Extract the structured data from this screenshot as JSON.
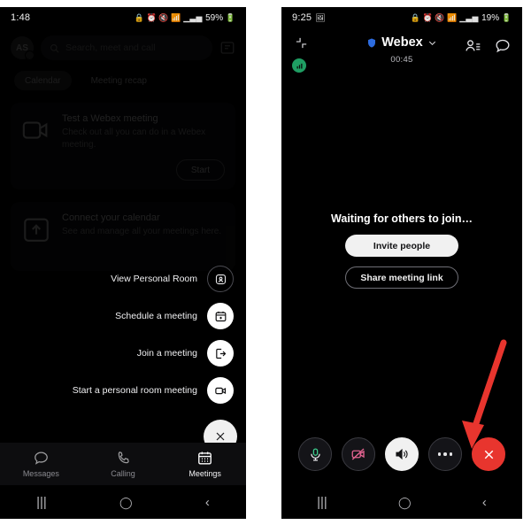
{
  "left_phone": {
    "status_bar": {
      "time": "1:48",
      "battery": "59%",
      "icons": [
        "lock-icon",
        "alarm-icon",
        "mute-icon",
        "wifi-icon",
        "signal-icon",
        "signal-bars-icon",
        "battery-icon"
      ]
    },
    "header": {
      "avatar_initials": "AS",
      "search_placeholder": "Search, meet and call",
      "compose_icon": "compose-icon"
    },
    "chips": [
      {
        "label": "Calendar",
        "filled": true
      },
      {
        "label": "Meeting recap",
        "filled": false
      }
    ],
    "cards": [
      {
        "icon": "video-camera-icon",
        "title": "Test a Webex meeting",
        "subtitle": "Check out all you can do in a Webex meeting.",
        "button": "Start"
      },
      {
        "icon": "calendar-connect-icon",
        "title": "Connect your calendar",
        "subtitle": "See and manage all your meetings here."
      }
    ],
    "fab_menu": {
      "items": [
        {
          "label": "View Personal Room",
          "icon": "personal-room-icon",
          "style": "ghost"
        },
        {
          "label": "Schedule a meeting",
          "icon": "calendar-plus-icon",
          "style": "white"
        },
        {
          "label": "Join a meeting",
          "icon": "join-meeting-icon",
          "style": "white"
        },
        {
          "label": "Start a personal room meeting",
          "icon": "video-start-icon",
          "style": "white"
        }
      ],
      "close_icon": "close-icon"
    },
    "tabs": [
      {
        "label": "Messages",
        "icon": "message-bubble-icon",
        "active": false
      },
      {
        "label": "Calling",
        "icon": "phone-icon",
        "active": false
      },
      {
        "label": "Meetings",
        "icon": "calendar-icon",
        "active": true
      }
    ],
    "nav_bar": {
      "recents": "recents-icon",
      "home": "home-icon",
      "back": "back-icon"
    }
  },
  "right_phone": {
    "status_bar": {
      "time": "9:25",
      "battery": "19%",
      "icons": [
        "screenshot-icon",
        "lock-icon",
        "alarm-icon",
        "mute-icon",
        "wifi-icon",
        "signal-icon",
        "signal-bars-icon",
        "battery-icon"
      ]
    },
    "meeting_header": {
      "collapse_icon": "collapse-icon",
      "network_quality_icon": "network-quality-icon",
      "shield_icon": "shield-icon",
      "title": "Webex",
      "chevron_icon": "chevron-down-icon",
      "timer": "00:45",
      "participants_icon": "participants-icon",
      "chat_icon": "chat-bubble-icon"
    },
    "center": {
      "waiting_text": "Waiting for others to join…",
      "invite_button": "Invite people",
      "share_button": "Share meeting link"
    },
    "controls": [
      {
        "name": "mic-button",
        "icon": "microphone-icon",
        "state": "on"
      },
      {
        "name": "video-button",
        "icon": "video-off-icon",
        "state": "off"
      },
      {
        "name": "speaker-button",
        "icon": "speaker-icon",
        "state": "active"
      },
      {
        "name": "more-options-button",
        "icon": "ellipsis-icon",
        "state": "default"
      },
      {
        "name": "end-call-button",
        "icon": "close-icon",
        "state": "danger"
      }
    ],
    "annotation": {
      "type": "arrow",
      "points_to": "more-options-button",
      "color": "#e8352e"
    },
    "nav_bar": {
      "recents": "recents-icon",
      "home": "home-icon",
      "back": "back-icon"
    }
  },
  "colors": {
    "background": "#ffffff",
    "screen": "#000000",
    "accent_red": "#e8352e",
    "accent_blue": "#2d6cdf",
    "accent_green": "#1f9e63",
    "mic_green": "#3ecf8e",
    "video_off_pink": "#e0628f"
  }
}
